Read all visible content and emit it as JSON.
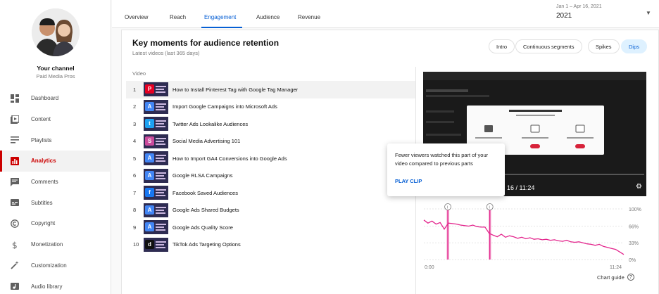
{
  "channel": {
    "title": "Your channel",
    "handle": "Paid Media Pros"
  },
  "nav": [
    {
      "label": "Dashboard",
      "icon": "dashboard-icon"
    },
    {
      "label": "Content",
      "icon": "content-icon"
    },
    {
      "label": "Playlists",
      "icon": "playlists-icon"
    },
    {
      "label": "Analytics",
      "icon": "analytics-icon",
      "active": true
    },
    {
      "label": "Comments",
      "icon": "comments-icon"
    },
    {
      "label": "Subtitles",
      "icon": "subtitles-icon"
    },
    {
      "label": "Copyright",
      "icon": "copyright-icon"
    },
    {
      "label": "Monetization",
      "icon": "monetization-icon"
    },
    {
      "label": "Customization",
      "icon": "customization-icon"
    },
    {
      "label": "Audio library",
      "icon": "audio-library-icon"
    }
  ],
  "tabs": [
    "Overview",
    "Reach",
    "Engagement",
    "Audience",
    "Revenue"
  ],
  "active_tab": "Engagement",
  "date": {
    "range": "Jan 1 – Apr 16, 2021",
    "year": "2021"
  },
  "card": {
    "title": "Key moments for audience retention",
    "subtitle": "Latest videos (last 365 days)",
    "chips": [
      "Intro",
      "Continuous segments",
      "Spikes",
      "Dips"
    ],
    "active_chip": "Dips",
    "column_header": "Video"
  },
  "videos": [
    {
      "num": "1",
      "title": "How to Install Pinterest Tag with Google Tag Manager",
      "logo": "P",
      "color": "#e60023"
    },
    {
      "num": "2",
      "title": "Import Google Campaigns into Microsoft Ads",
      "logo": "A",
      "color": "#4285f4"
    },
    {
      "num": "3",
      "title": "Twitter Ads Lookalike Audiences",
      "logo": "t",
      "color": "#1da1f2"
    },
    {
      "num": "4",
      "title": "Social Media Advertising 101",
      "logo": "S",
      "color": "#c94a9c"
    },
    {
      "num": "5",
      "title": "How to Import GA4 Conversions into Google Ads",
      "logo": "A",
      "color": "#4285f4"
    },
    {
      "num": "6",
      "title": "Google RLSA Campaigns",
      "logo": "A",
      "color": "#4285f4"
    },
    {
      "num": "7",
      "title": "Facebook Saved Audiences",
      "logo": "f",
      "color": "#1877f2"
    },
    {
      "num": "8",
      "title": "Google Ads Shared Budgets",
      "logo": "A",
      "color": "#4285f4"
    },
    {
      "num": "9",
      "title": "Google Ads Quality Score",
      "logo": "A",
      "color": "#4285f4"
    },
    {
      "num": "10",
      "title": "TikTok Ads Targeting Options",
      "logo": "d",
      "color": "#111111"
    }
  ],
  "video_preview": {
    "time": "16 / 11:24"
  },
  "tooltip": {
    "text": "Fewer viewers watched this part of your video compared to previous parts",
    "action": "PLAY CLIP"
  },
  "chart_data": {
    "type": "line",
    "x_start_label": "0:00",
    "x_end_label": "11:24",
    "y_ticks": [
      "100%",
      "66%",
      "33%",
      "0%"
    ],
    "ylim": [
      0,
      100
    ],
    "series": [
      {
        "values": [
          78,
          72,
          76,
          70,
          73,
          60,
          72,
          71,
          70,
          68,
          67,
          66,
          68,
          65,
          64,
          64,
          52,
          48,
          45,
          50,
          44,
          47,
          45,
          42,
          44,
          41,
          43,
          40,
          41,
          39,
          40,
          38,
          39,
          37,
          36,
          38,
          35,
          34,
          35,
          33,
          31,
          30,
          28,
          30,
          26,
          24,
          22,
          20,
          15,
          10
        ]
      }
    ],
    "color": "#e3248c",
    "highlights": [
      {
        "x": 0.12
      },
      {
        "x": 0.33
      }
    ],
    "link_label": "Chart guide"
  },
  "colors": {
    "accent": "#065fd4",
    "active_nav": "#cc0000",
    "retention_line": "#e3248c"
  }
}
